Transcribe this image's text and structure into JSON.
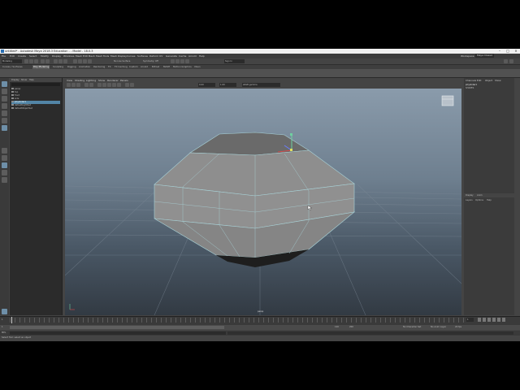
{
  "window": {
    "title": "untitled* - Autodesk Maya 2018.3 Education - - Model - 18.0.3"
  },
  "menubar": {
    "items": [
      "File",
      "Edit",
      "Create",
      "Select",
      "Modify",
      "Display",
      "Windows",
      "Mesh",
      "Edit Mesh",
      "Mesh Tools",
      "Mesh Display",
      "Curves",
      "Surfaces",
      "Deform",
      "UV",
      "Generate",
      "Cache",
      "Arnold",
      "Help"
    ],
    "workspace_label": "Workspace:",
    "workspace_value": "Maya Classic"
  },
  "statusline": {
    "mode": "Modeling",
    "no_live_surface": "No Live Surface",
    "symmetry": "Symmetry: Off",
    "sign_in": "Sign In"
  },
  "shelf": {
    "tabs": [
      "Curves / Surfaces",
      "Poly Modeling",
      "Sculpting",
      "Rigging",
      "Animation",
      "Rendering",
      "FX",
      "FX Caching",
      "Custom",
      "Arnold",
      "Bifrost",
      "MASH",
      "Motion Graphics",
      "XGen"
    ],
    "active_tab": "Poly Modeling"
  },
  "outliner": {
    "menus": [
      "Display",
      "Show",
      "Help"
    ],
    "items": [
      {
        "label": "persp",
        "selected": false
      },
      {
        "label": "top",
        "selected": false
      },
      {
        "label": "front",
        "selected": false
      },
      {
        "label": "side",
        "selected": false
      },
      {
        "label": "pCylinder1",
        "selected": true
      },
      {
        "label": "defaultLightSet",
        "selected": false
      },
      {
        "label": "defaultObjectSet",
        "selected": false
      }
    ]
  },
  "viewport": {
    "menus": [
      "View",
      "Shading",
      "Lighting",
      "Show",
      "Renderer",
      "Panels"
    ],
    "gamma": "sRGB gamma",
    "camera_label": "persp",
    "exposure": "0.00",
    "gamma_value": "1.00"
  },
  "channel_box": {
    "tabs": [
      "Channels",
      "Edit",
      "Object",
      "Show"
    ],
    "object": "pCylinder1",
    "shape_section": "SHAPES",
    "layer_tabs": [
      "Display",
      "Anim"
    ],
    "layer_menus": [
      "Layers",
      "Options",
      "Help"
    ]
  },
  "timeline": {
    "start": "1",
    "end": "120",
    "range_start": "1",
    "range_end": "120",
    "anim_end": "200",
    "current_frame": "1",
    "character_set": "No Character Set",
    "anim_layer": "No Anim Layer",
    "fps": "24 fps"
  },
  "command_line": {
    "label": "MEL"
  },
  "help_line": {
    "text": "Select Tool: select an object"
  },
  "colors": {
    "accent": "#5285a6",
    "mesh": "#8e8e8e",
    "wire": "#9ad0d6",
    "background": "#444444"
  },
  "icons": {
    "select_tool": "arrow-icon",
    "lasso_tool": "lasso-icon",
    "paint_select": "brush-icon",
    "move_tool": "move-icon",
    "rotate_tool": "rotate-icon",
    "scale_tool": "scale-icon",
    "view_cube": "viewcube-icon"
  }
}
